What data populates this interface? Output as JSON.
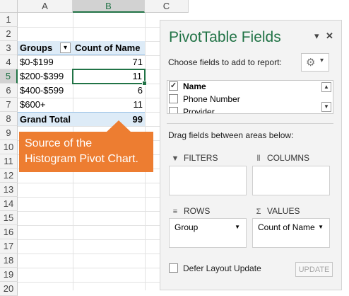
{
  "columns": [
    "A",
    "B",
    "C"
  ],
  "rows": [
    "1",
    "2",
    "3",
    "4",
    "5",
    "6",
    "7",
    "8",
    "9",
    "10",
    "11",
    "12",
    "13",
    "14",
    "15",
    "16",
    "17",
    "18",
    "19",
    "20"
  ],
  "pivot": {
    "header_groups": "Groups",
    "header_count": "Count of Name",
    "items": [
      {
        "label": "$0-$199",
        "value": "71"
      },
      {
        "label": "$200-$399",
        "value": "11"
      },
      {
        "label": "$400-$599",
        "value": "6"
      },
      {
        "label": "$600+",
        "value": "11"
      }
    ],
    "total_label": "Grand Total",
    "total_value": "99"
  },
  "callout": {
    "line1": "Source of the",
    "line2": "Histogram Pivot Chart.",
    "color": "#ed7d31"
  },
  "pane": {
    "title": "PivotTable Fields",
    "choose_label": "Choose fields to add to report:",
    "fields": [
      {
        "name": "Name",
        "checked": true
      },
      {
        "name": "Phone Number",
        "checked": false
      },
      {
        "name": "Provider",
        "checked": false
      }
    ],
    "drag_label": "Drag fields between areas below:",
    "filters_label": "FILTERS",
    "columns_label": "COLUMNS",
    "rows_label": "ROWS",
    "values_label": "VALUES",
    "rows_item": "Group",
    "values_item": "Count of Name",
    "defer_label": "Defer Layout Update",
    "update_label": "UPDATE",
    "accent_color": "#217346"
  },
  "icons": {
    "dropdown": "▾",
    "close": "✕",
    "gear": "⚙",
    "check": "✓",
    "scroll_up": "▲",
    "scroll_down": "▼",
    "filter": "▼",
    "columns": "⦀",
    "rows": "≡",
    "values": "Σ"
  }
}
